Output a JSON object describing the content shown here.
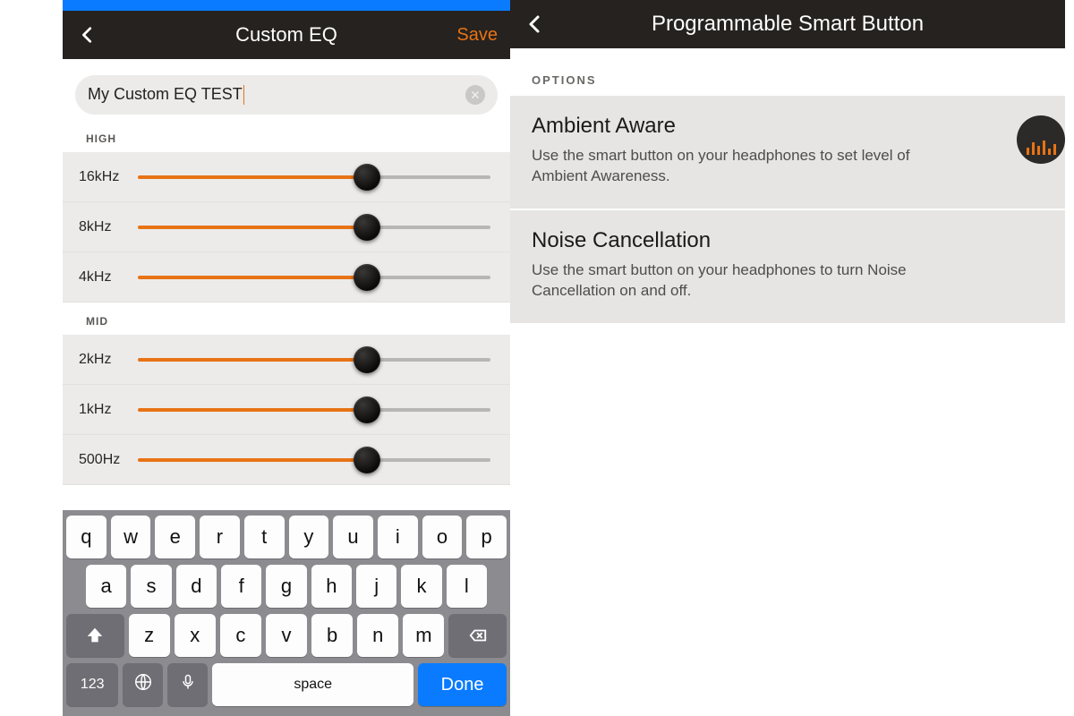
{
  "left": {
    "header": {
      "title": "Custom EQ",
      "save": "Save"
    },
    "name_field": {
      "value": "My Custom EQ TEST"
    },
    "sections": {
      "high": {
        "label": "HIGH",
        "bands": [
          {
            "freq": "16kHz",
            "value": 65
          },
          {
            "freq": "8kHz",
            "value": 65
          },
          {
            "freq": "4kHz",
            "value": 65
          }
        ]
      },
      "mid": {
        "label": "MID",
        "bands": [
          {
            "freq": "2kHz",
            "value": 65
          },
          {
            "freq": "1kHz",
            "value": 65
          },
          {
            "freq": "500Hz",
            "value": 65
          }
        ]
      }
    },
    "keyboard": {
      "row1": [
        "q",
        "w",
        "e",
        "r",
        "t",
        "y",
        "u",
        "i",
        "o",
        "p"
      ],
      "row2": [
        "a",
        "s",
        "d",
        "f",
        "g",
        "h",
        "j",
        "k",
        "l"
      ],
      "row3": [
        "z",
        "x",
        "c",
        "v",
        "b",
        "n",
        "m"
      ],
      "mode_key": "123",
      "space": "space",
      "done": "Done"
    }
  },
  "right": {
    "header": {
      "title": "Programmable Smart Button"
    },
    "options_label": "OPTIONS",
    "options": [
      {
        "title": "Ambient Aware",
        "desc": "Use the smart button on your headphones to set level of Ambient Awareness.",
        "selected": true
      },
      {
        "title": "Noise Cancellation",
        "desc": "Use the smart button on your headphones to turn Noise Cancellation on and off.",
        "selected": false
      }
    ]
  }
}
